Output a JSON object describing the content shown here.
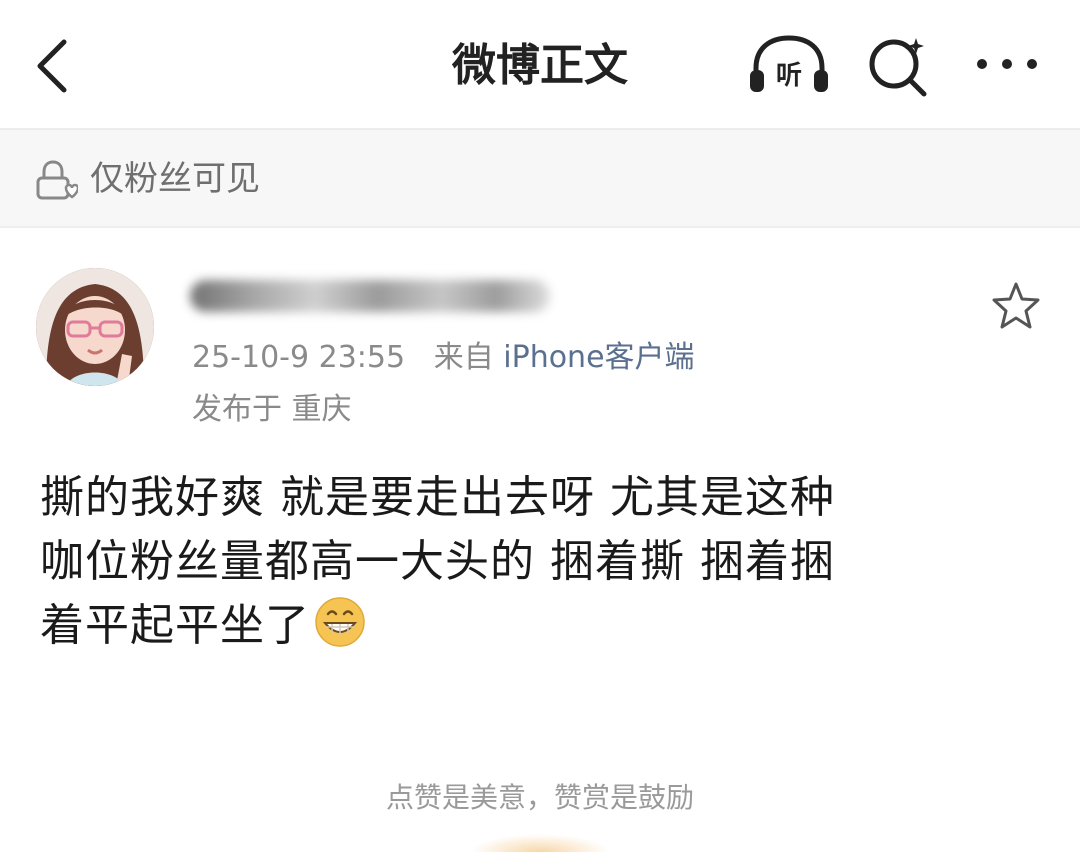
{
  "header": {
    "title": "微博正文",
    "listen_label": "听",
    "icons": {
      "back": "chevron-left-icon",
      "listen": "headphones-icon",
      "search": "search-icon",
      "more": "more-dots-icon"
    }
  },
  "visibility": {
    "text": "仅粉丝可见",
    "icon": "lock-heart-icon"
  },
  "post": {
    "username_redacted": true,
    "timestamp": "25-10-9 23:55",
    "from_prefix": "来自",
    "source": "iPhone客户端",
    "location": "发布于 重庆",
    "body_lines": [
      "撕的我好爽 就是要走出去呀 尤其是这种",
      "咖位粉丝量都高一大头的 捆着撕 捆着捆",
      "着平起平坐了"
    ],
    "emoji": "grinning-face-emoji",
    "favorite_icon": "star-outline-icon"
  },
  "footer": {
    "reward_text": "点赞是美意，赞赏是鼓励"
  },
  "colors": {
    "meta_gray": "#8a8a8a",
    "source_blue": "#5b6f8f",
    "divider": "#ececec"
  }
}
